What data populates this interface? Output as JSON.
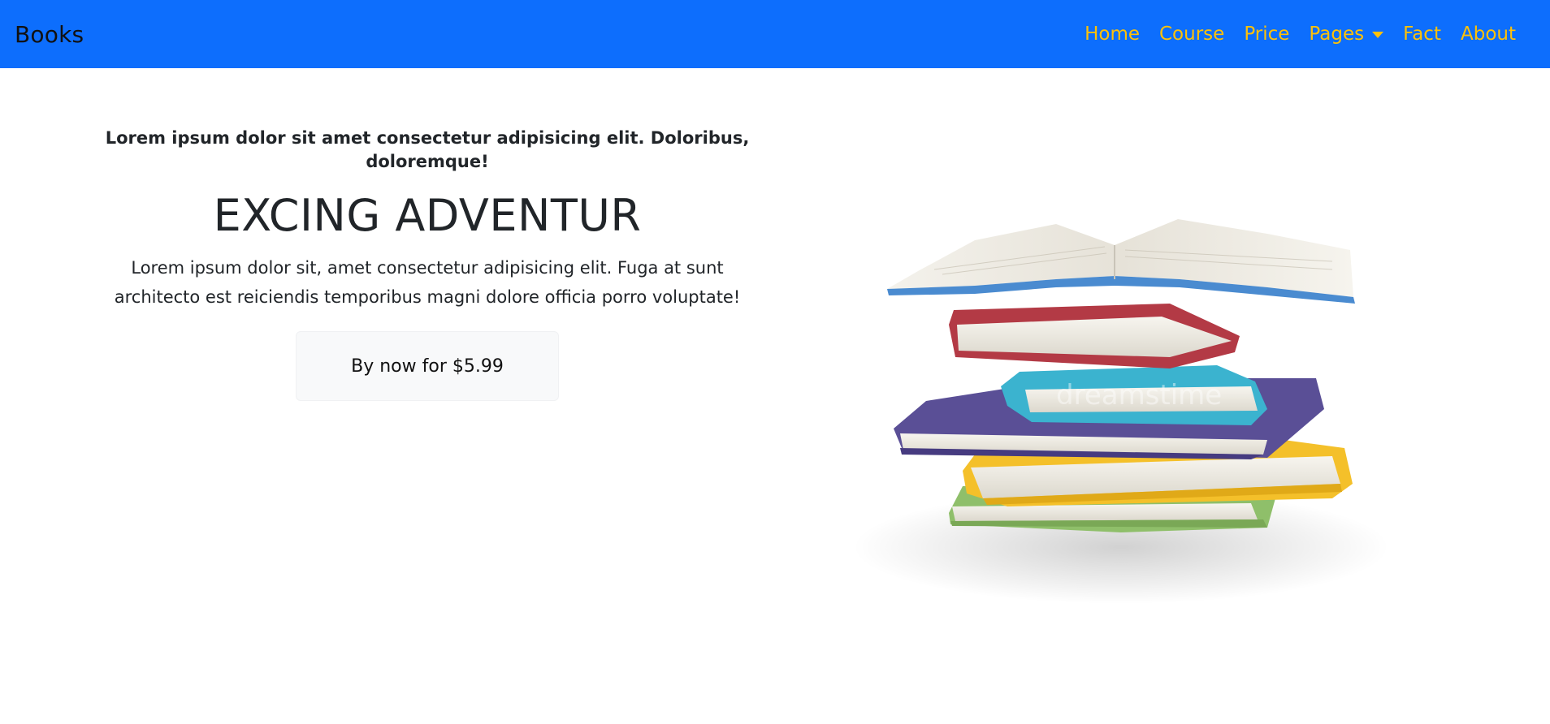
{
  "navbar": {
    "brand": "Books",
    "links": [
      {
        "label": "Home"
      },
      {
        "label": "Course"
      },
      {
        "label": "Price"
      },
      {
        "label": "Pages"
      },
      {
        "label": "Fact"
      },
      {
        "label": "About"
      }
    ]
  },
  "hero": {
    "lead": "Lorem ipsum dolor sit amet consectetur adipisicing elit. Doloribus, doloremque!",
    "headline": "EXCING ADVENTUR",
    "body": "Lorem ipsum dolor sit, amet consectetur adipisicing elit. Fuga at sunt architecto est reiciendis temporibus magni dolore officia porro voluptate!",
    "button_label": "By now for $5.99",
    "image_watermark": "dreamstime"
  },
  "colors": {
    "navbar_bg": "#0d6efd",
    "nav_link": "#ffc107",
    "button_bg": "#f8f9fa",
    "text": "#212529"
  },
  "icons": {
    "dropdown": "caret-down-icon"
  }
}
